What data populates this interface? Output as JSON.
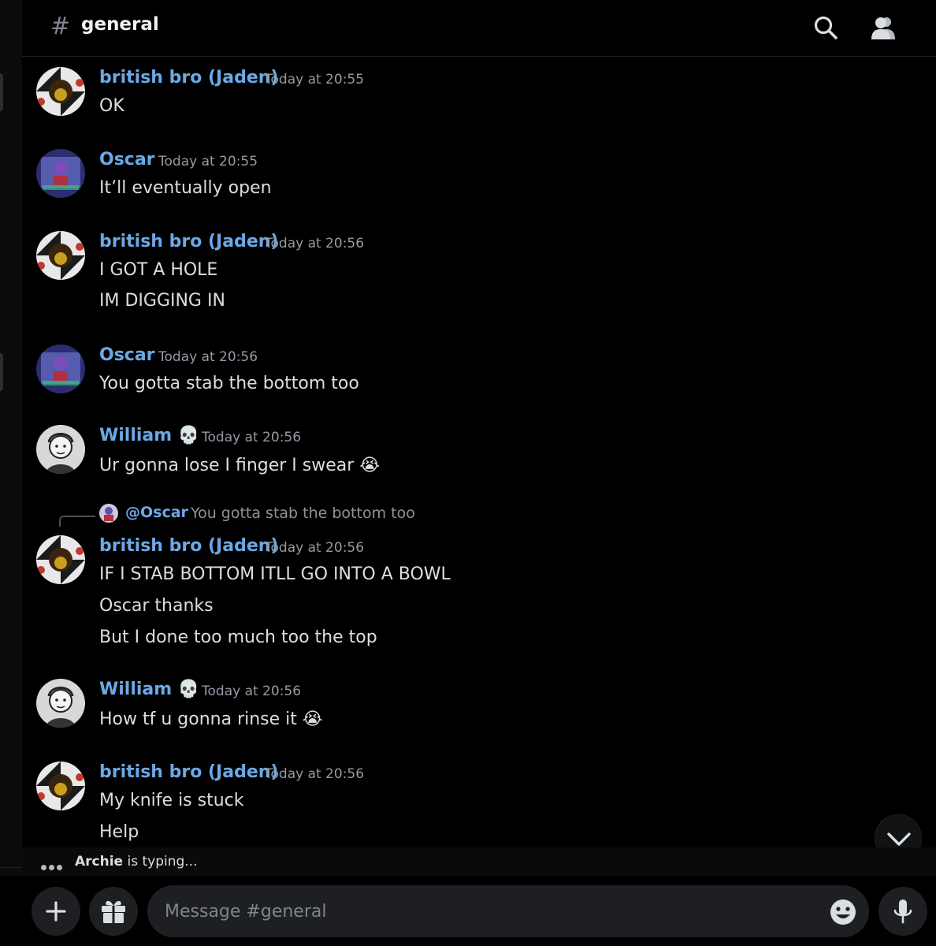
{
  "channel": {
    "name": "general"
  },
  "messages": [
    {
      "user": "british bro (Jaden)",
      "time": "Today at 20:55",
      "lines": [
        "OK"
      ]
    },
    {
      "user": "Oscar",
      "time": "Today at 20:55",
      "lines": [
        "It’ll eventually open"
      ]
    },
    {
      "user": "british bro (Jaden)",
      "time": "Today at 20:56",
      "lines": [
        "I GOT A HOLE",
        "IM DIGGING IN"
      ]
    },
    {
      "user": "Oscar",
      "time": "Today at 20:56",
      "lines": [
        "You gotta stab the bottom too"
      ]
    },
    {
      "user": "William",
      "user_emoji": "💀",
      "time": "Today at 20:56",
      "lines": [
        "Ur gonna lose I finger I swear"
      ],
      "line_emoji": "😭"
    },
    {
      "user": "british bro (Jaden)",
      "time": "Today at 20:56",
      "reply": {
        "user": "@Oscar",
        "text": "You gotta stab the bottom too"
      },
      "lines": [
        "IF I STAB BOTTOM ITLL GO INTO A BOWL",
        "Oscar thanks",
        "But I done too much too the top"
      ]
    },
    {
      "user": "William",
      "user_emoji": "💀",
      "time": "Today at 20:56",
      "lines": [
        "How tf u gonna rinse it"
      ],
      "line_emoji": "😭"
    },
    {
      "user": "british bro (Jaden)",
      "time": "Today at 20:56",
      "lines": [
        "My knife is stuck",
        "Help"
      ]
    }
  ],
  "typing": {
    "user": "Archie",
    "suffix": "is typing..."
  },
  "composer": {
    "placeholder": "Message #general"
  },
  "icons": {
    "header": [
      "search-icon",
      "members-icon"
    ],
    "composer": [
      "plus-icon",
      "gift-icon",
      "emoji-icon",
      "microphone-icon"
    ],
    "scroll": "chevron-down-icon"
  },
  "colors": {
    "username": "#6ca8e6",
    "background": "#000000",
    "input": "#1e1f22"
  }
}
